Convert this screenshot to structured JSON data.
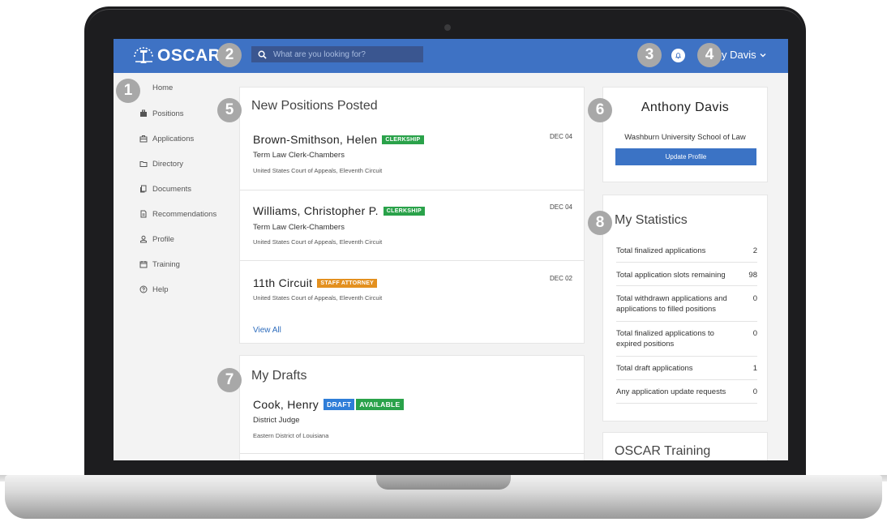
{
  "app": {
    "logo_text": "OSCAR",
    "search_placeholder": "What are you looking for?",
    "user_menu_label": "y Davis"
  },
  "sidebar": {
    "items": [
      {
        "label": "Home",
        "icon": "home-icon"
      },
      {
        "label": "Positions",
        "icon": "briefcase-icon"
      },
      {
        "label": "Applications",
        "icon": "applications-icon"
      },
      {
        "label": "Directory",
        "icon": "directory-icon"
      },
      {
        "label": "Documents",
        "icon": "documents-icon"
      },
      {
        "label": "Recommendations",
        "icon": "recommendations-icon"
      },
      {
        "label": "Profile",
        "icon": "profile-icon"
      },
      {
        "label": "Training",
        "icon": "training-icon"
      },
      {
        "label": "Help",
        "icon": "help-icon"
      }
    ]
  },
  "new_positions": {
    "title": "New Positions Posted",
    "items": [
      {
        "name": "Brown-Smithson, Helen",
        "tag": "CLERKSHIP",
        "date": "DEC 04",
        "role": "Term Law Clerk-Chambers",
        "court": "United States Court of Appeals, Eleventh Circuit"
      },
      {
        "name": "Williams, Christopher P.",
        "tag": "CLERKSHIP",
        "date": "DEC 04",
        "role": "Term Law Clerk-Chambers",
        "court": "United States Court of Appeals, Eleventh Circuit"
      },
      {
        "name": "11th Circuit",
        "tag": "STAFF ATTORNEY",
        "date": "DEC 02",
        "court": "United States Court of Appeals, Eleventh Circuit"
      }
    ],
    "view_all": "View All"
  },
  "drafts": {
    "title": "My Drafts",
    "items": [
      {
        "name": "Cook, Henry",
        "tag_draft": "DRAFT",
        "tag_status": "AVAILABLE",
        "role": "District Judge",
        "court": "Eastern District of Louisiana"
      }
    ]
  },
  "profile": {
    "name": "Anthony Davis",
    "school": "Washburn University School of Law",
    "update_button": "Update Profile"
  },
  "statistics": {
    "title": "My Statistics",
    "rows": [
      {
        "label": "Total finalized applications",
        "value": "2"
      },
      {
        "label": "Total application slots remaining",
        "value": "98"
      },
      {
        "label": "Total withdrawn applications and applications to filled positions",
        "value": "0"
      },
      {
        "label": "Total finalized applications to expired positions",
        "value": "0"
      },
      {
        "label": "Total draft applications",
        "value": "1"
      },
      {
        "label": "Any application update requests",
        "value": "0"
      }
    ]
  },
  "training": {
    "title": "OSCAR Training"
  },
  "callouts": [
    "1",
    "2",
    "3",
    "4",
    "5",
    "6",
    "7",
    "8"
  ],
  "colors": {
    "header": "#3e72c4",
    "clerkship_tag": "#2aa24a",
    "staff_attorney_tag": "#e3901f",
    "draft_tag": "#2f7ed8",
    "callout": "#a8a8a8"
  }
}
